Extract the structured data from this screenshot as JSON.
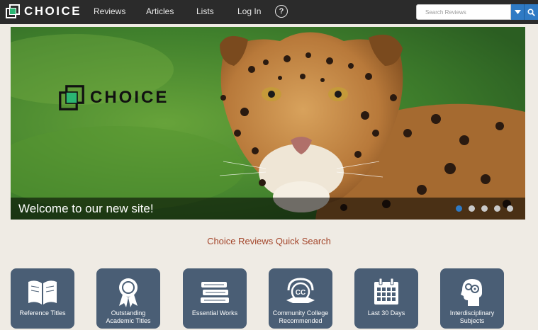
{
  "brand": {
    "name": "CHOICE",
    "accent": "#2bb673"
  },
  "nav": {
    "items": [
      {
        "label": "Reviews"
      },
      {
        "label": "Articles"
      },
      {
        "label": "Lists"
      },
      {
        "label": "Log In"
      }
    ],
    "help_icon": "question-circle-icon"
  },
  "search": {
    "placeholder": "Search Reviews",
    "dropdown_icon": "caret-down-icon",
    "button_icon": "search-icon"
  },
  "hero": {
    "caption": "Welcome to our new site!",
    "logo_text": "CHOICE",
    "slides": {
      "count": 5,
      "active_index": 0
    }
  },
  "quick_search": {
    "title": "Choice Reviews Quick Search",
    "tiles": [
      {
        "label": "Reference Titles",
        "icon": "open-book-icon"
      },
      {
        "label": "Outstanding Academic Titles",
        "icon": "award-ribbon-icon"
      },
      {
        "label": "Essential Works",
        "icon": "stacked-books-icon"
      },
      {
        "label": "Community College Recommended",
        "icon": "cc-badge-icon"
      },
      {
        "label": "Last 30 Days",
        "icon": "calendar-icon"
      },
      {
        "label": "Interdisciplinary Subjects",
        "icon": "head-gears-icon"
      }
    ]
  },
  "colors": {
    "navbar": "#2b2b2b",
    "tile": "#4a5e75",
    "search_blue": "#2f7ac4",
    "title_red": "#a3452a"
  }
}
